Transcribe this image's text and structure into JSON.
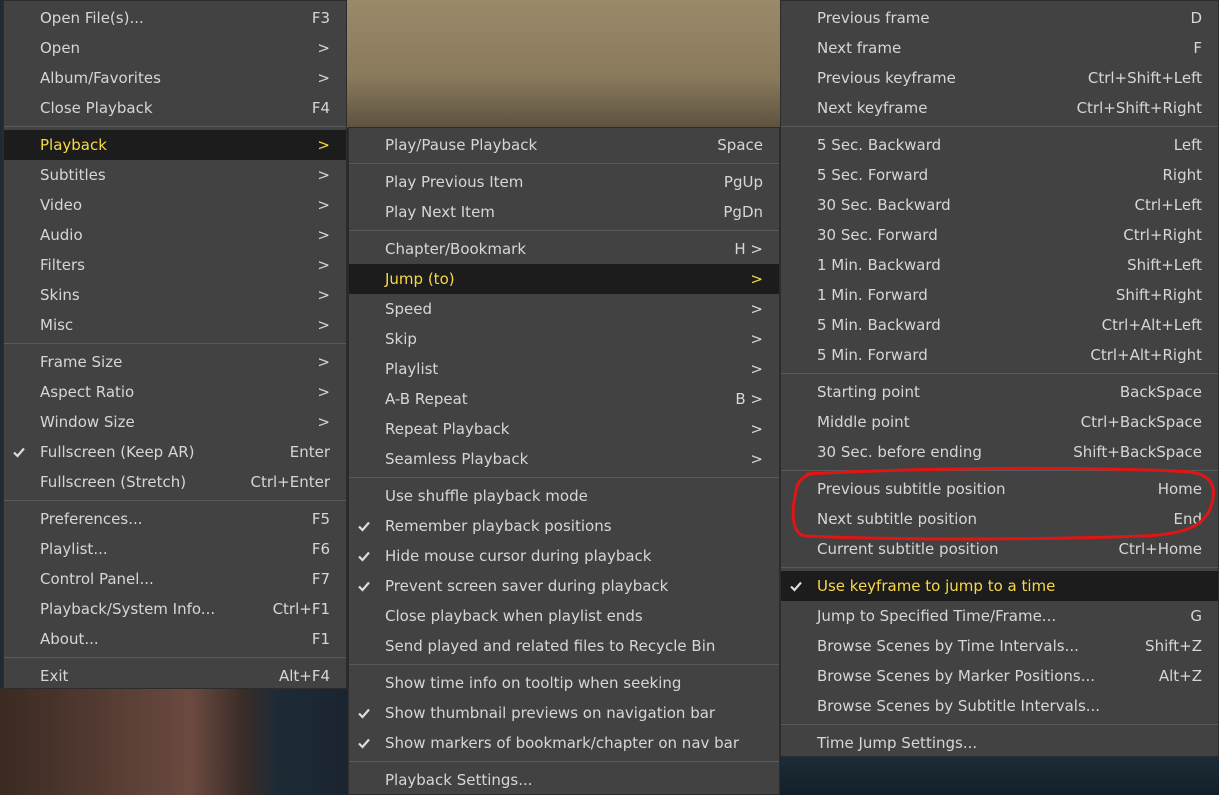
{
  "menu_main": {
    "items": [
      {
        "label": "Open File(s)...",
        "shortcut": "F3"
      },
      {
        "label": "Open",
        "shortcut": ">"
      },
      {
        "label": "Album/Favorites",
        "shortcut": ">"
      },
      {
        "label": "Close Playback",
        "shortcut": "F4"
      },
      {
        "label": "Playback",
        "shortcut": ">"
      },
      {
        "label": "Subtitles",
        "shortcut": ">"
      },
      {
        "label": "Video",
        "shortcut": ">"
      },
      {
        "label": "Audio",
        "shortcut": ">"
      },
      {
        "label": "Filters",
        "shortcut": ">"
      },
      {
        "label": "Skins",
        "shortcut": ">"
      },
      {
        "label": "Misc",
        "shortcut": ">"
      },
      {
        "label": "Frame Size",
        "shortcut": ">"
      },
      {
        "label": "Aspect Ratio",
        "shortcut": ">"
      },
      {
        "label": "Window Size",
        "shortcut": ">"
      },
      {
        "label": "Fullscreen (Keep AR)",
        "shortcut": "Enter",
        "checked": true
      },
      {
        "label": "Fullscreen (Stretch)",
        "shortcut": "Ctrl+Enter"
      },
      {
        "label": "Preferences...",
        "shortcut": "F5"
      },
      {
        "label": "Playlist...",
        "shortcut": "F6"
      },
      {
        "label": "Control Panel...",
        "shortcut": "F7"
      },
      {
        "label": "Playback/System Info...",
        "shortcut": "Ctrl+F1"
      },
      {
        "label": "About...",
        "shortcut": "F1"
      },
      {
        "label": "Exit",
        "shortcut": "Alt+F4"
      }
    ]
  },
  "menu_playback": {
    "items": [
      {
        "label": "Play/Pause Playback",
        "shortcut": "Space"
      },
      {
        "label": "Play Previous Item",
        "shortcut": "PgUp"
      },
      {
        "label": "Play Next Item",
        "shortcut": "PgDn"
      },
      {
        "label": "Chapter/Bookmark",
        "shortcut": "H >"
      },
      {
        "label": "Jump (to)",
        "shortcut": ">"
      },
      {
        "label": "Speed",
        "shortcut": ">"
      },
      {
        "label": "Skip",
        "shortcut": ">"
      },
      {
        "label": "Playlist",
        "shortcut": ">"
      },
      {
        "label": "A-B Repeat",
        "shortcut": "B >"
      },
      {
        "label": "Repeat Playback",
        "shortcut": ">"
      },
      {
        "label": "Seamless Playback",
        "shortcut": ">"
      },
      {
        "label": "Use shuffle playback mode",
        "shortcut": ""
      },
      {
        "label": "Remember playback positions",
        "shortcut": "",
        "checked": true
      },
      {
        "label": "Hide mouse cursor during playback",
        "shortcut": "",
        "checked": true
      },
      {
        "label": "Prevent screen saver during playback",
        "shortcut": "",
        "checked": true
      },
      {
        "label": "Close playback when playlist ends",
        "shortcut": ""
      },
      {
        "label": "Send played and related files to Recycle Bin",
        "shortcut": ""
      },
      {
        "label": "Show time info on tooltip when seeking",
        "shortcut": ""
      },
      {
        "label": "Show thumbnail previews on navigation bar",
        "shortcut": "",
        "checked": true
      },
      {
        "label": "Show markers of bookmark/chapter on nav bar",
        "shortcut": "",
        "checked": true
      },
      {
        "label": "Playback Settings...",
        "shortcut": ""
      }
    ]
  },
  "menu_jump": {
    "items": [
      {
        "label": "Previous frame",
        "shortcut": "D"
      },
      {
        "label": "Next frame",
        "shortcut": "F"
      },
      {
        "label": "Previous keyframe",
        "shortcut": "Ctrl+Shift+Left"
      },
      {
        "label": "Next keyframe",
        "shortcut": "Ctrl+Shift+Right"
      },
      {
        "label": "5 Sec. Backward",
        "shortcut": "Left"
      },
      {
        "label": "5 Sec. Forward",
        "shortcut": "Right"
      },
      {
        "label": "30 Sec. Backward",
        "shortcut": "Ctrl+Left"
      },
      {
        "label": "30 Sec. Forward",
        "shortcut": "Ctrl+Right"
      },
      {
        "label": "1 Min. Backward",
        "shortcut": "Shift+Left"
      },
      {
        "label": "1 Min. Forward",
        "shortcut": "Shift+Right"
      },
      {
        "label": "5 Min. Backward",
        "shortcut": "Ctrl+Alt+Left"
      },
      {
        "label": "5 Min. Forward",
        "shortcut": "Ctrl+Alt+Right"
      },
      {
        "label": "Starting point",
        "shortcut": "BackSpace"
      },
      {
        "label": "Middle point",
        "shortcut": "Ctrl+BackSpace"
      },
      {
        "label": "30 Sec. before ending",
        "shortcut": "Shift+BackSpace"
      },
      {
        "label": "Previous subtitle position",
        "shortcut": "Home"
      },
      {
        "label": "Next subtitle position",
        "shortcut": "End"
      },
      {
        "label": "Current subtitle position",
        "shortcut": "Ctrl+Home"
      },
      {
        "label": "Use keyframe to jump to a time",
        "shortcut": "",
        "checked": true
      },
      {
        "label": "Jump to Specified Time/Frame...",
        "shortcut": "G"
      },
      {
        "label": "Browse Scenes by Time Intervals...",
        "shortcut": "Shift+Z"
      },
      {
        "label": "Browse Scenes by Marker Positions...",
        "shortcut": "Alt+Z"
      },
      {
        "label": "Browse Scenes by Subtitle Intervals...",
        "shortcut": ""
      },
      {
        "label": "Time Jump Settings...",
        "shortcut": ""
      }
    ]
  },
  "colors": {
    "highlight_text": "#f7d84a",
    "annotation": "#e01515"
  }
}
